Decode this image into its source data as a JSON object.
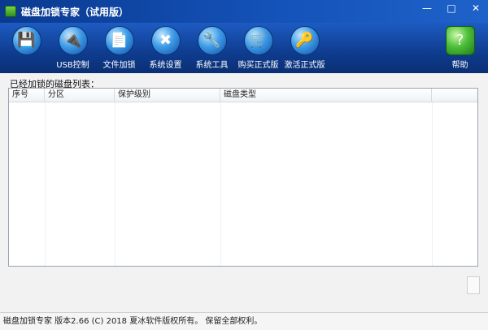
{
  "window": {
    "title": "磁盘加锁专家（试用版）",
    "controls": [
      "—",
      "□",
      "✕"
    ]
  },
  "toolbar": {
    "items": [
      {
        "label": "",
        "icon": "save-icon",
        "glyph": "💾"
      },
      {
        "label": "USB控制",
        "icon": "usb-icon",
        "glyph": "🔌"
      },
      {
        "label": "文件加锁",
        "icon": "file-icon",
        "glyph": "📄"
      },
      {
        "label": "系统设置",
        "icon": "tools-icon",
        "glyph": "✖"
      },
      {
        "label": "系统工具",
        "icon": "wrench-icon",
        "glyph": "🔧"
      },
      {
        "label": "购买正式版",
        "icon": "cart-icon",
        "glyph": "🛒"
      },
      {
        "label": "激活正式版",
        "icon": "key-icon",
        "glyph": "🔑"
      }
    ],
    "help": {
      "label": "帮助",
      "icon": "help-icon",
      "glyph": "?"
    }
  },
  "disk_list": {
    "label": "已经加锁的磁盘列表：",
    "columns": [
      "序号",
      "分区",
      "保护级别",
      "磁盘类型",
      ""
    ]
  },
  "statusbar": {
    "text": "磁盘加锁专家  版本2.66  (C)   2018 夏冰软件版权所有。  保留全部权利。"
  }
}
